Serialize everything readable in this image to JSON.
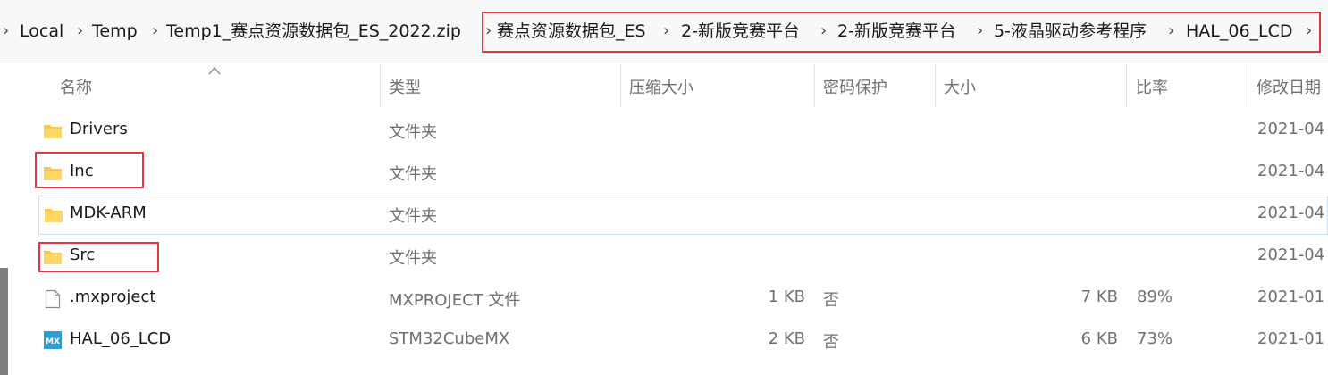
{
  "breadcrumb": {
    "items": [
      "Local",
      "Temp",
      "Temp1_赛点资源数据包_ES_2022.zip",
      "赛点资源数据包_ES",
      "2-新版竞赛平台",
      "2-新版竞赛平台",
      "5-液晶驱动参考程序",
      "HAL_06_LCD"
    ],
    "separator": "›"
  },
  "columns": {
    "name": "名称",
    "type": "类型",
    "compressed_size": "压缩大小",
    "password_protected": "密码保护",
    "size": "大小",
    "ratio": "比率",
    "modified": "修改日期"
  },
  "files": [
    {
      "name": "Drivers",
      "type": "文件夹",
      "compressed_size": "",
      "password": "",
      "size": "",
      "ratio": "",
      "modified": "2021-04",
      "icon": "folder-icon"
    },
    {
      "name": "Inc",
      "type": "文件夹",
      "compressed_size": "",
      "password": "",
      "size": "",
      "ratio": "",
      "modified": "2021-04",
      "icon": "folder-icon"
    },
    {
      "name": "MDK-ARM",
      "type": "文件夹",
      "compressed_size": "",
      "password": "",
      "size": "",
      "ratio": "",
      "modified": "2021-04",
      "icon": "folder-icon"
    },
    {
      "name": "Src",
      "type": "文件夹",
      "compressed_size": "",
      "password": "",
      "size": "",
      "ratio": "",
      "modified": "2021-04",
      "icon": "folder-icon"
    },
    {
      "name": ".mxproject",
      "type": "MXPROJECT 文件",
      "compressed_size": "1 KB",
      "password": "否",
      "size": "7 KB",
      "ratio": "89%",
      "modified": "2021-01",
      "icon": "document-icon"
    },
    {
      "name": "HAL_06_LCD",
      "type": "STM32CubeMX",
      "compressed_size": "2 KB",
      "password": "否",
      "size": "6 KB",
      "ratio": "73%",
      "modified": "2021-01",
      "icon": "stm32cubemx-icon"
    }
  ],
  "mx_icon_text": "MX",
  "colors": {
    "highlight_box": "#e0393e",
    "folder": "#f8c94a",
    "mx_icon": "#2c9fd9",
    "selection_border": "#c7dff5"
  }
}
